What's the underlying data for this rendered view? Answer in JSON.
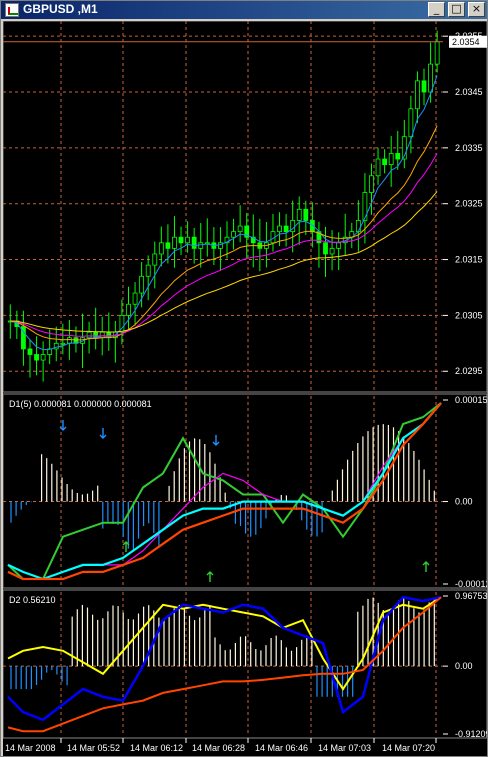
{
  "window": {
    "title": "GBPUSD ,M1",
    "buttons": [
      "_",
      "□",
      "×"
    ]
  },
  "main_chart": {
    "price_ticks": [
      "2.0355",
      "2.0345",
      "2.0335",
      "2.0325",
      "2.0315",
      "2.0305",
      "2.0295"
    ],
    "current_price": "2.0354",
    "colors": {
      "bull": "#00ff00",
      "bear": "#00ff00",
      "ma1": "#1e90ff",
      "ma2": "#ffa500",
      "ma3": "#ff00ff",
      "ma4": "#ffd700",
      "grid": "#c8643c"
    }
  },
  "indicator1": {
    "label": "D1(5) 0.000081 0.000000 0.000081",
    "ticks": [
      "0.00015",
      "0.00",
      "-0.00012"
    ]
  },
  "indicator2": {
    "label": "D2 0.56210",
    "ticks": [
      "0.96753",
      "0.00",
      "-0.91209"
    ]
  },
  "time_axis": [
    "14 Mar 2008",
    "14 Mar 05:52",
    "14 Mar 06:12",
    "14 Mar 06:28",
    "14 Mar 06:46",
    "14 Mar 07:03",
    "14 Mar 07:20"
  ],
  "chart_data": [
    {
      "type": "candlestick",
      "price_range": [
        2.0292,
        2.0357
      ],
      "close_series": [
        2.0304,
        2.0303,
        2.0299,
        2.0298,
        2.0297,
        2.0298,
        2.0299,
        2.03,
        2.03,
        2.0301,
        2.03,
        2.0301,
        2.0302,
        2.0301,
        2.0302,
        2.0301,
        2.0302,
        2.0305,
        2.0307,
        2.0309,
        2.0312,
        2.0314,
        2.0316,
        2.0318,
        2.0317,
        2.0319,
        2.0318,
        2.0319,
        2.0317,
        2.0318,
        2.0318,
        2.0317,
        2.0318,
        2.0319,
        2.032,
        2.0321,
        2.0319,
        2.0318,
        2.0317,
        2.0318,
        2.032,
        2.0321,
        2.032,
        2.0322,
        2.0324,
        2.0322,
        2.032,
        2.0318,
        2.0316,
        2.0317,
        2.0318,
        2.0319,
        2.032,
        2.0322,
        2.0327,
        2.033,
        2.0333,
        2.0332,
        2.0334,
        2.0333,
        2.0337,
        2.0342,
        2.0347,
        2.0345,
        2.035,
        2.0354
      ],
      "ma_series": [
        {
          "name": "ma-fast",
          "color": "#1e90ff"
        },
        {
          "name": "ma-medium",
          "color": "#ffa500"
        },
        {
          "name": "ma-slow",
          "color": "#ff00ff"
        },
        {
          "name": "ma-slowest",
          "color": "#ffd700"
        }
      ]
    },
    {
      "type": "histogram+line",
      "ylim": [
        -0.00012,
        0.00015
      ]
    },
    {
      "type": "histogram+line",
      "ylim": [
        -0.91209,
        0.96753
      ]
    }
  ]
}
